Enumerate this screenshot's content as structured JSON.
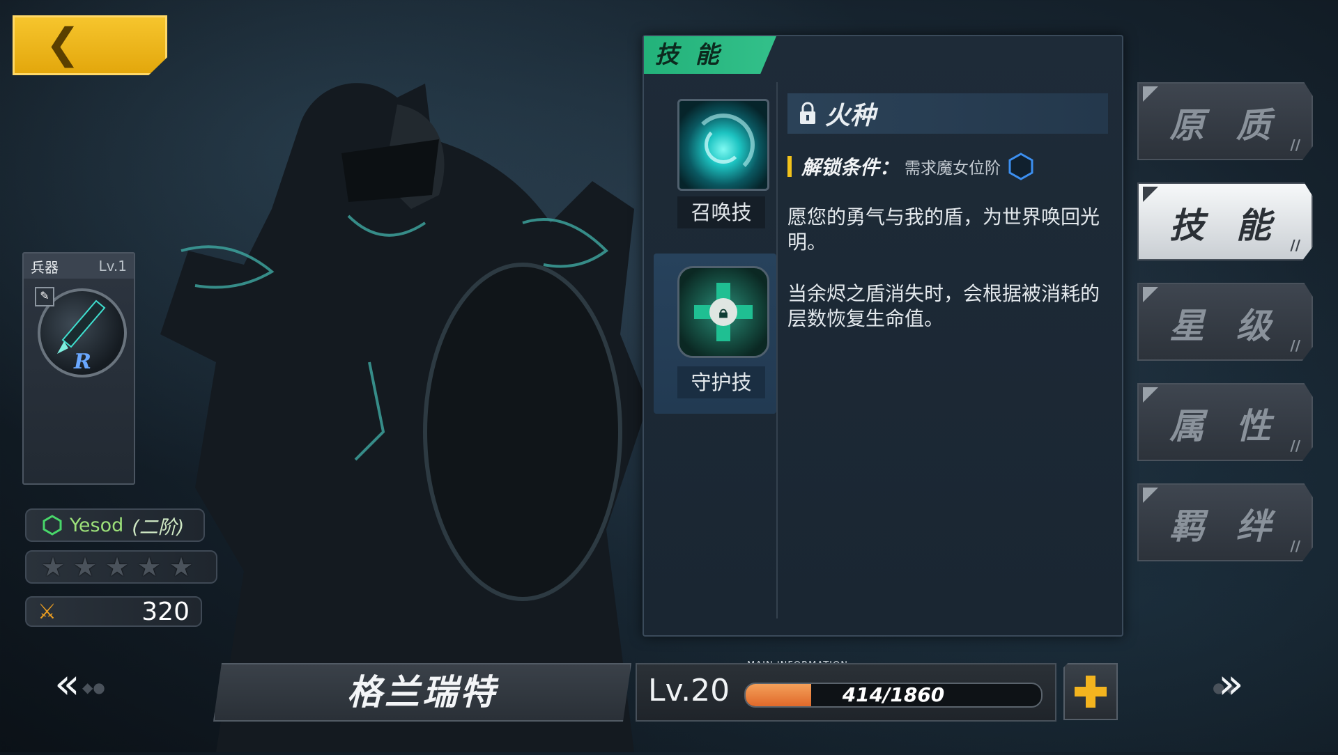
{
  "back_button": {
    "icon": "chevron-left-icon",
    "color": "#f2bb1e"
  },
  "weapon": {
    "header": "兵器",
    "level": "Lv.1",
    "rank": "R"
  },
  "stats": {
    "class_name": "Yesod",
    "class_tier": "(二阶)",
    "stars_total": 5,
    "stars_filled": 0,
    "power_value": "320"
  },
  "skill_panel": {
    "title": "技 能",
    "skills": [
      {
        "label": "召唤技",
        "icon": "vortex-icon"
      },
      {
        "label": "守护技",
        "icon": "locked-shield-icon"
      }
    ],
    "detail": {
      "name": "火种",
      "unlock_key": "解锁条件：",
      "unlock_value": "需求魔女位阶",
      "desc1": "愿您的勇气与我的盾，为世界唤回光明。",
      "desc2": "当余烬之盾消失时，会根据被消耗的层数恢复生命值。"
    }
  },
  "side_tabs": [
    {
      "label": "原 质",
      "active": false
    },
    {
      "label": "技 能",
      "active": true
    },
    {
      "label": "星 级",
      "active": false
    },
    {
      "label": "属 性",
      "active": false
    },
    {
      "label": "羁 绊",
      "active": false
    }
  ],
  "bottom_bar": {
    "prev": "«",
    "next": "»",
    "character_name": "格兰瑞特",
    "level": "Lv.20",
    "xp_text": "414/1860",
    "xp_current": 414,
    "xp_max": 1860,
    "main_info": "MAIN INFORMATION"
  },
  "colors": {
    "accent_green": "#23b27a",
    "xp_orange": "#e77a35",
    "gold": "#f3b41f"
  }
}
